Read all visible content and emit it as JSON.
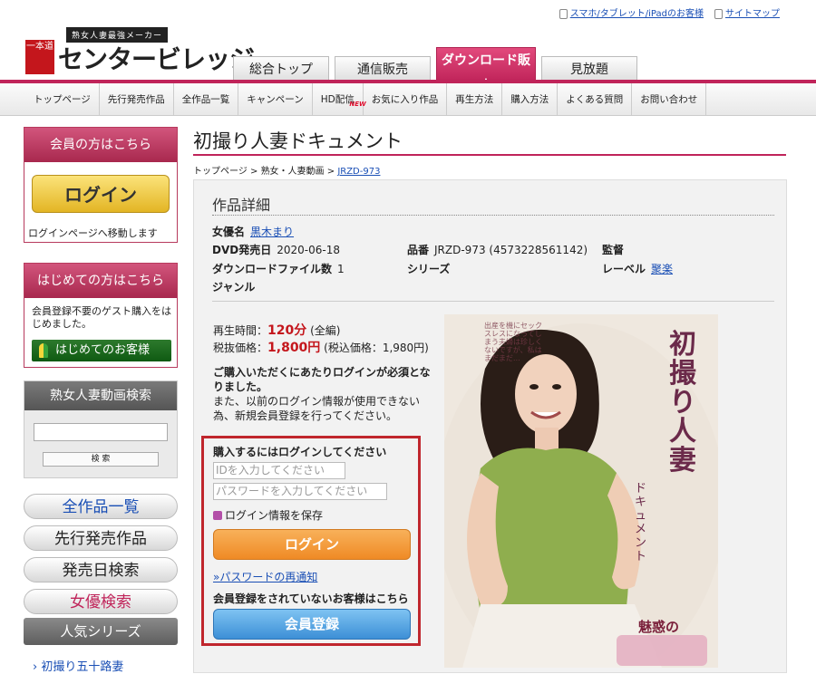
{
  "header": {
    "top_links": [
      "スマホ/タブレット/iPadのお客様",
      "サイトマップ"
    ],
    "logo_tagline": "熟女人妻最強メーカー",
    "logo_mark": "一本道",
    "logo_text": "センタービレッジ",
    "tabs": [
      {
        "label": "総合トップ",
        "active": false
      },
      {
        "label": "通信販売",
        "active": false
      },
      {
        "label": "ダウンロード販売",
        "active": true
      },
      {
        "label": "見放題",
        "active": false
      }
    ]
  },
  "nav": {
    "items": [
      "トップページ",
      "先行発売作品",
      "全作品一覧",
      "キャンペーン",
      "HD配信",
      "お気に入り作品",
      "再生方法",
      "購入方法",
      "よくある質問",
      "お問い合わせ"
    ],
    "new_badge": "NEW"
  },
  "sidebar": {
    "member_heading": "会員の方はこちら",
    "login_button": "ログイン",
    "login_note": "ログインページへ移動します",
    "first_heading": "はじめての方はこちら",
    "first_note": "会員登録不要のゲスト購入をはじめました。",
    "first_button": "はじめてのお客様",
    "search_heading": "熟女人妻動画検索",
    "search_button": "検 索",
    "menu": [
      "全作品一覧",
      "先行発売作品",
      "発売日検索",
      "女優検索"
    ],
    "popular_heading": "人気シリーズ",
    "popular_item": "初撮り五十路妻"
  },
  "main": {
    "title": "初撮り人妻ドキュメント",
    "breadcrumb": [
      "トップページ",
      "熟女・人妻動画",
      "JRZD-973"
    ],
    "detail_heading": "作品詳細",
    "fields": {
      "actress_label": "女優名",
      "actress": "黒木まり",
      "release_label": "DVD発売日",
      "release": "2020-06-18",
      "product_label": "品番",
      "product": "JRZD-973 (4573228561142)",
      "director_label": "監督",
      "files_label": "ダウンロードファイル数",
      "files": "1",
      "series_label": "シリーズ",
      "label_label": "レーベル",
      "label": "聚楽",
      "genre_label": "ジャンル"
    },
    "duration_label": "再生時間：",
    "duration": "120分",
    "duration_note": "(全編)",
    "price_label": "税抜価格：",
    "price": "1,800円",
    "price_note": "(税込価格：1,980円)",
    "notice_bold": "ご購入いただくにあたりログインが必須となりました。",
    "notice_text": "また、以前のログイン情報が使用できない為、新規会員登録を行ってください。",
    "login_panel": {
      "heading": "購入するにはログインしてください",
      "id_placeholder": "IDを入力してください",
      "password_placeholder": "パスワードを入力してください",
      "remember": "ログイン情報を保存",
      "login_button": "ログイン",
      "remind_link": "»パスワードの再通知",
      "register_note": "会員登録をされていないお客様はこちら",
      "register_button": "会員登録"
    },
    "cover": {
      "title_vertical": "初撮り人妻",
      "subtitle": "ドキュメント",
      "tagline": "魅惑の",
      "catchcopy": "出産を機にセックスレスになってしまう夫婦は珍しくないですが、私はまだまだ…"
    }
  },
  "colors": {
    "brand": "#c0245a",
    "link": "#1a4fb5",
    "price": "#c4161c",
    "highlight_border": "#c0262d"
  }
}
